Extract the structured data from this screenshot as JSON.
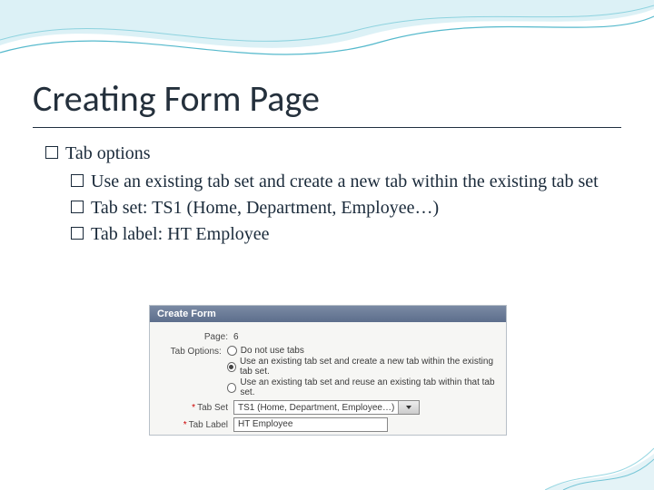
{
  "title": "Creating Form Page",
  "bullets": {
    "lvl1_1": "Tab options",
    "lvl2_1": "Use an existing tab set and create a new tab within the existing tab set",
    "lvl2_2": "Tab set: TS1 (Home, Department, Employee…)",
    "lvl2_3": "Tab label: HT Employee"
  },
  "form": {
    "header": "Create Form",
    "page_label": "Page:",
    "page_value": "6",
    "tab_options_label": "Tab Options:",
    "opt1": "Do not use tabs",
    "opt2": "Use an existing tab set and create a new tab within the existing tab set.",
    "opt3": "Use an existing tab set and reuse an existing tab within that tab set.",
    "tab_set_label": "Tab Set",
    "tab_set_value": "TS1 (Home, Department, Employee…)",
    "tab_label_label": "Tab Label",
    "tab_label_value": "HT Employee"
  }
}
